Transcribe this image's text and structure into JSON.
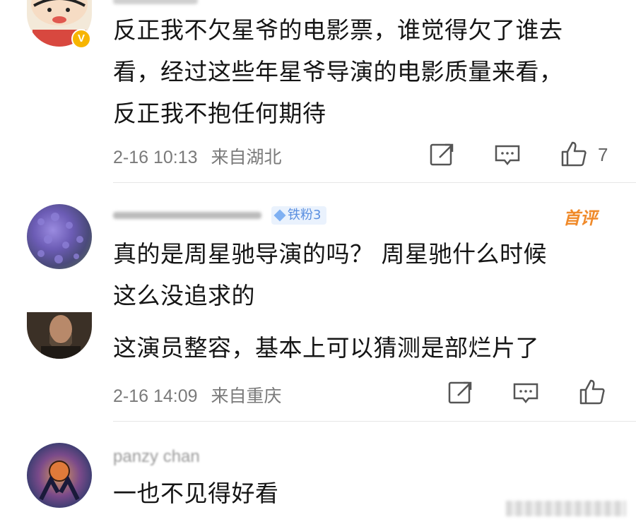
{
  "comments": [
    {
      "text_lines": [
        "反正我不欠星爷的电影票，谁觉得欠了谁去",
        "看，经过这些年星爷导演的电影质量来看，",
        "反正我不抱任何期待"
      ],
      "time": "2-16 10:13",
      "location": "来自湖北",
      "likes": "7",
      "avatar": "cartoon-boy-avatar",
      "verified_badge": "V"
    },
    {
      "badge": "铁粉3",
      "first_comment_tag": "首评",
      "text_lines": [
        "真的是周星驰导演的吗？ 周星驰什么时候",
        "这么没追求的"
      ],
      "avatar": "purple-flowers-avatar"
    },
    {
      "text_lines": [
        "这演员整容，基本上可以猜测是部烂片了"
      ],
      "time": "2-16 14:09",
      "location": "来自重庆",
      "avatar": "portrait-painting-avatar"
    },
    {
      "username": "panzy chan",
      "text_lines": [
        "一也不见得好看"
      ],
      "avatar": "basketball-art-avatar"
    }
  ],
  "colors": {
    "accent_orange": "#f08a2a",
    "badge_blue": "#6fa3ef",
    "meta_gray": "#7a7a7a"
  }
}
